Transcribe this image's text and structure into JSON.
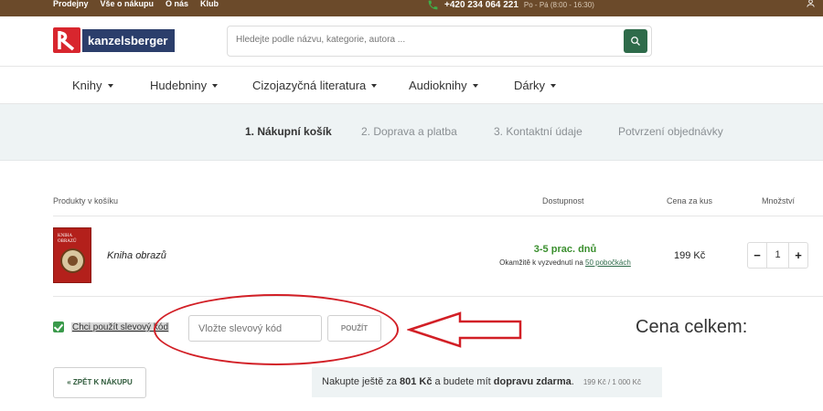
{
  "topbar": {
    "links": [
      "Prodejny",
      "Vše o nákupu",
      "O nás",
      "Klub"
    ],
    "phone": "+420 234 064 221",
    "hours": "Po - Pá (8:00 - 16:30)"
  },
  "header": {
    "logo_text": "kanzelsberger",
    "search_placeholder": "Hledejte podle názvu, kategorie, autora ..."
  },
  "nav": {
    "items": [
      "Knihy",
      "Hudebniny",
      "Cizojazyčná literatura",
      "Audioknihy",
      "Dárky"
    ]
  },
  "steps": [
    "1. Nákupní košík",
    "2. Doprava a platba",
    "3. Kontaktní údaje",
    "Potvrzení objednávky"
  ],
  "table": {
    "headers": {
      "product": "Produkty v košíku",
      "availability": "Dostupnost",
      "price": "Cena za kus",
      "quantity": "Množství"
    },
    "row": {
      "cover_title": "KNIHA OBRAZŮ",
      "name": "Kniha obrazů",
      "availability_days": "3-5 prac. dnů",
      "availability_note": "Okamžitě k vyzvednutí na",
      "availability_link": "50 pobočkách",
      "price": "199 Kč",
      "qty": "1"
    }
  },
  "coupon": {
    "checkbox_label": "Chci použít slevový kód",
    "input_placeholder": "Vložte slevový kód",
    "apply_label": "POUŽÍT",
    "total_label": "Cena celkem:"
  },
  "bottom": {
    "back_label": "« ZPĚT K NÁKUPU",
    "ship_pre": "Nakupte ještě za",
    "ship_amount": "801 Kč",
    "ship_mid": "a budete mít",
    "ship_free": "dopravu zdarma",
    "ship_dot": ".",
    "ship_progress": "199 Kč / 1 000 Kč"
  },
  "colors": {
    "topbar": "#6b4a2a",
    "accent_green": "#2e6b4a",
    "annotation_red": "#d21f26"
  }
}
